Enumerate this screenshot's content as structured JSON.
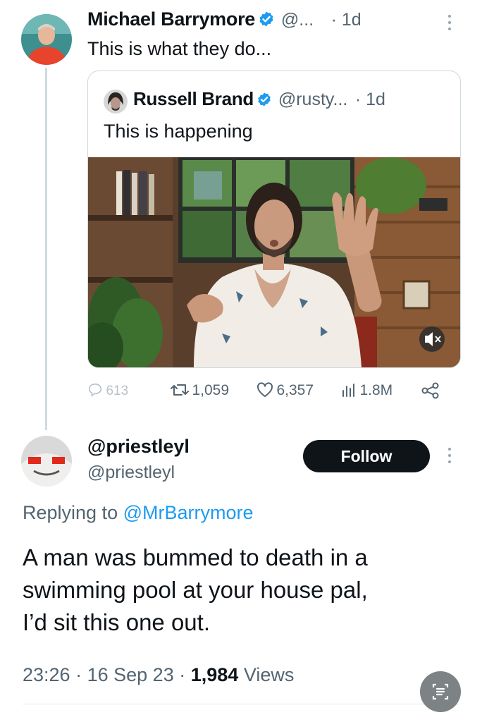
{
  "main_tweet": {
    "author_name": "Michael Barrymore",
    "handle": "@...",
    "time": "· 1d",
    "text": "This is what they do..."
  },
  "quoted_tweet": {
    "author_name": "Russell Brand",
    "handle": "@rusty...",
    "time": "· 1d",
    "text": "This is happening"
  },
  "stats": {
    "replies": "613",
    "retweets": "1,059",
    "likes": "6,357",
    "views": "1.8M"
  },
  "reply_tweet": {
    "author_name": "@priestleyl",
    "handle": "@priestleyl",
    "follow_label": "Follow",
    "replying_prefix": "Replying to ",
    "replying_to": "@MrBarrymore",
    "text_lines": [
      "A man was bummed to death in a",
      "swimming pool at your house pal,",
      "I’d sit this one out."
    ],
    "time": "23:26",
    "date": "16 Sep 23",
    "views_count": "1,984",
    "views_label": "Views"
  },
  "colors": {
    "verified": "#1d9bf0",
    "muted": "#536471",
    "link": "#1d9bf0",
    "follow_bg": "#0f1419"
  },
  "icons": [
    "verified-badge-icon",
    "more-options-icon",
    "reply-icon",
    "retweet-icon",
    "like-icon",
    "views-icon",
    "share-icon",
    "mute-icon",
    "floating-action-icon"
  ]
}
